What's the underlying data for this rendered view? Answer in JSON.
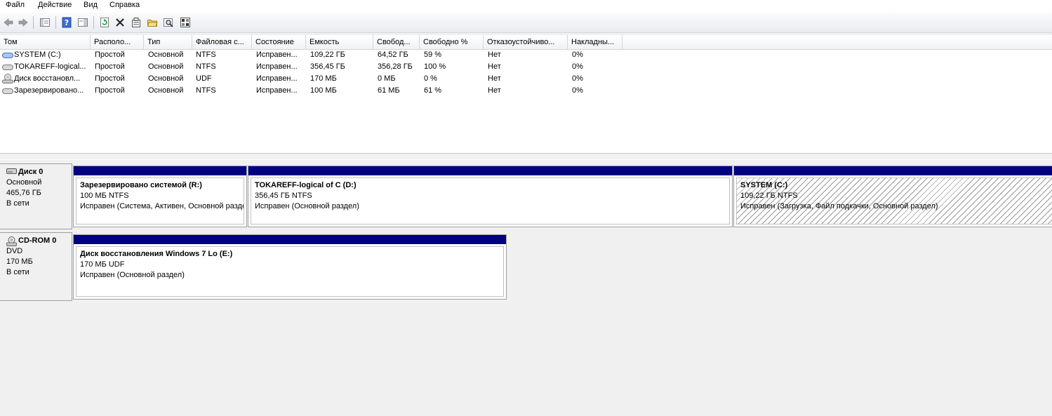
{
  "menu": [
    "Файл",
    "Действие",
    "Вид",
    "Справка"
  ],
  "toolbar": {
    "icons": [
      "back-arrow-icon",
      "forward-arrow-icon",
      "show-hide-tree-icon",
      "help-icon",
      "properties-pane-icon",
      "refresh-icon",
      "delete-icon",
      "properties-icon",
      "open-icon",
      "search-icon",
      "export-icon"
    ]
  },
  "colors": {
    "partition_bar": "#000080",
    "window_bg": "#f0f0f0"
  },
  "volumes": {
    "columns": [
      "Том",
      "Располо...",
      "Тип",
      "Файловая с...",
      "Состояние",
      "Емкость",
      "Свобод...",
      "Свободно %",
      "Отказоустойчиво...",
      "Накладны..."
    ],
    "rows": [
      {
        "icon": "volume-drive-icon",
        "cells": [
          "SYSTEM (C:)",
          "Простой",
          "Основной",
          "NTFS",
          "Исправен...",
          "109,22 ГБ",
          "64,52 ГБ",
          "59 %",
          "Нет",
          "0%"
        ]
      },
      {
        "icon": "volume-drive-icon",
        "cells": [
          "TOKAREFF-logical...",
          "Простой",
          "Основной",
          "NTFS",
          "Исправен...",
          "356,45 ГБ",
          "356,28 ГБ",
          "100 %",
          "Нет",
          "0%"
        ]
      },
      {
        "icon": "cd-drive-icon",
        "cells": [
          "Диск восстановл...",
          "Простой",
          "Основной",
          "UDF",
          "Исправен...",
          "170 МБ",
          "0 МБ",
          "0 %",
          "Нет",
          "0%"
        ]
      },
      {
        "icon": "volume-drive-icon",
        "cells": [
          "Зарезервировано...",
          "Простой",
          "Основной",
          "NTFS",
          "Исправен...",
          "100 МБ",
          "61 МБ",
          "61 %",
          "Нет",
          "0%"
        ]
      }
    ]
  },
  "disks": [
    {
      "name": "Диск 0",
      "type": "Основной",
      "size": "465,76 ГБ",
      "status": "В сети",
      "partitions": [
        {
          "name": "Зарезервировано системой  (R:)",
          "size": "100 МБ NTFS",
          "status": "Исправен (Система, Активен, Основной раздел)",
          "hatched": false
        },
        {
          "name": "TOKAREFF-logical of C  (D:)",
          "size": "356,45 ГБ NTFS",
          "status": "Исправен (Основной раздел)",
          "hatched": false
        },
        {
          "name": "SYSTEM  (C:)",
          "size": "109,22 ГБ NTFS",
          "status": "Исправен (Загрузка, Файл подкачки, Основной раздел)",
          "hatched": true
        }
      ]
    },
    {
      "name": "CD-ROM 0",
      "type": "DVD",
      "size": "170 МБ",
      "status": "В сети",
      "partitions": [
        {
          "name": "Диск восстановления Windows 7 Lo  (E:)",
          "size": "170 МБ UDF",
          "status": "Исправен (Основной раздел)",
          "hatched": false
        }
      ]
    }
  ]
}
